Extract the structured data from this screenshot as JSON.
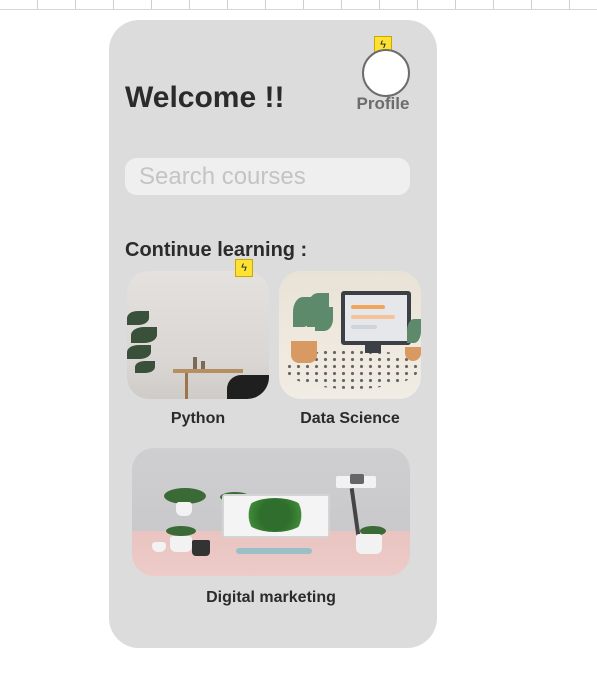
{
  "header": {
    "welcome_text": "Welcome !!",
    "profile_label": "Profile"
  },
  "search": {
    "placeholder": "Search courses",
    "value": ""
  },
  "section": {
    "title": "Continue learning :"
  },
  "courses": [
    {
      "label": "Python",
      "image": "room-with-plant-shelf"
    },
    {
      "label": "Data Science",
      "image": "desk-with-monitor-plants"
    },
    {
      "label": "Digital marketing",
      "image": "desk-with-screen-bush"
    }
  ],
  "icons": {
    "badge": "flash-icon",
    "badge_glyph": "ϟ"
  },
  "colors": {
    "panel_bg": "#dcdcdc",
    "search_bg": "#efefef",
    "badge": "#fde234",
    "text": "#2b2b2b",
    "muted": "#6c6c6c"
  }
}
